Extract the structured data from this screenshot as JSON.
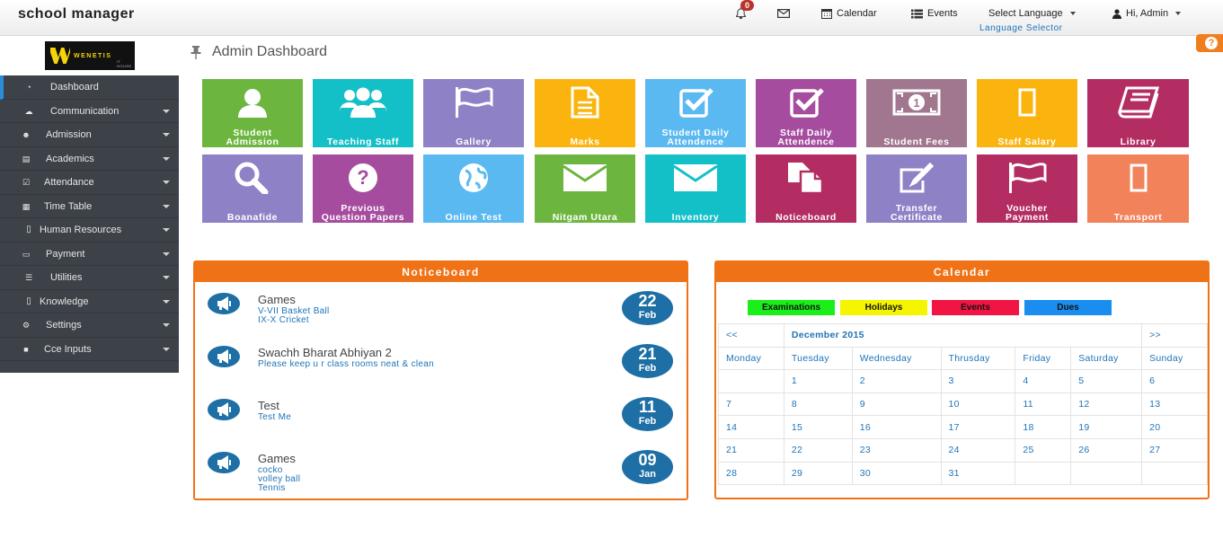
{
  "app": {
    "title": "school manager"
  },
  "topnav": {
    "notifications_count": "0",
    "calendar_label": "Calendar",
    "events_label": "Events",
    "language_label": "Select Language",
    "language_sub": "Language Selector",
    "user_label": "Hi, Admin"
  },
  "logo": {
    "text": "WENETIS",
    "sub": "IT HOUSE"
  },
  "sidebar": {
    "items": [
      {
        "label": "Dashboard",
        "icon": "dashboard-icon"
      },
      {
        "label": "Communication",
        "icon": "comments-icon"
      },
      {
        "label": "Admission",
        "icon": "users-icon"
      },
      {
        "label": "Academics",
        "icon": "keyboard-icon"
      },
      {
        "label": "Attendance",
        "icon": "check-square-icon"
      },
      {
        "label": "Time Table",
        "icon": "table-icon"
      },
      {
        "label": "Human Resources",
        "icon": "missing-glyph-icon"
      },
      {
        "label": "Payment",
        "icon": "money-icon"
      },
      {
        "label": "Utilities",
        "icon": "server-icon"
      },
      {
        "label": "Knowledge",
        "icon": "missing-glyph-icon"
      },
      {
        "label": "Settings",
        "icon": "cogs-icon"
      },
      {
        "label": "Cce Inputs",
        "icon": "folder-icon"
      }
    ]
  },
  "page": {
    "title": "Admin Dashboard"
  },
  "tiles": [
    {
      "label": "Student\nAdmission",
      "icon": "user-icon",
      "color": "#6cb63f"
    },
    {
      "label": "Teaching Staff",
      "icon": "group-icon",
      "color": "#13c0c8"
    },
    {
      "label": "Gallery",
      "icon": "flag-icon",
      "color": "#8f81c6"
    },
    {
      "label": "Marks",
      "icon": "file-text-icon",
      "color": "#fbb40e"
    },
    {
      "label": "Student Daily\nAttendence",
      "icon": "check-square-icon",
      "color": "#5bb9f1"
    },
    {
      "label": "Staff Daily\nAttendence",
      "icon": "check-square-icon",
      "color": "#a64c9e"
    },
    {
      "label": "Student Fees",
      "icon": "money-icon",
      "color": "#a1778f"
    },
    {
      "label": "Staff Salary",
      "icon": "missing-glyph-icon",
      "color": "#fbb40e"
    },
    {
      "label": "Library",
      "icon": "book-icon",
      "color": "#b32d63"
    },
    {
      "label": "Boanafide",
      "icon": "search-icon",
      "color": "#8f81c6"
    },
    {
      "label": "Previous\nQuestion Papers",
      "icon": "question-icon",
      "color": "#a64c9e"
    },
    {
      "label": "Online Test",
      "icon": "globe-icon",
      "color": "#5bb9f1"
    },
    {
      "label": "Nitgam Utara",
      "icon": "envelope-icon",
      "color": "#6cb63f"
    },
    {
      "label": "Inventory",
      "icon": "envelope-icon",
      "color": "#13c0c8"
    },
    {
      "label": "Noticeboard",
      "icon": "files-icon",
      "color": "#b32d63"
    },
    {
      "label": "Transfer\nCertificate",
      "icon": "edit-icon",
      "color": "#8f81c6"
    },
    {
      "label": "Voucher\nPayment",
      "icon": "flag-icon",
      "color": "#b32d63"
    },
    {
      "label": "Transport",
      "icon": "missing-glyph-icon",
      "color": "#f1825a"
    }
  ],
  "noticeboard": {
    "title": "Noticeboard",
    "items": [
      {
        "title": "Games",
        "lines": [
          "V-VII Basket Ball",
          "IX-X Cricket"
        ],
        "day": "22",
        "month": "Feb"
      },
      {
        "title": "Swachh Bharat Abhiyan 2",
        "lines": [
          "Please keep u r class rooms neat & clean"
        ],
        "day": "21",
        "month": "Feb"
      },
      {
        "title": "Test",
        "lines": [
          "Test Me"
        ],
        "day": "11",
        "month": "Feb"
      },
      {
        "title": "Games",
        "lines": [
          "cocko",
          "volley ball",
          "Tennis"
        ],
        "day": "09",
        "month": "Jan"
      }
    ]
  },
  "calendar": {
    "title": "Calendar",
    "legend": [
      {
        "label": "Examinations",
        "color": "#1aef1a"
      },
      {
        "label": "Holidays",
        "color": "#f5f500"
      },
      {
        "label": "Events",
        "color": "#f01542"
      },
      {
        "label": "Dues",
        "color": "#1a8ef0"
      }
    ],
    "prev": "<<",
    "next": ">>",
    "month": "December 2015",
    "weekdays": [
      "Monday",
      "Tuesday",
      "Wednesday",
      "Thrusday",
      "Friday",
      "Saturday",
      "Sunday"
    ],
    "weeks": [
      [
        "",
        "1",
        "2",
        "3",
        "4",
        "5",
        "6"
      ],
      [
        "7",
        "8",
        "9",
        "10",
        "11",
        "12",
        "13"
      ],
      [
        "14",
        "15",
        "16",
        "17",
        "18",
        "19",
        "20"
      ],
      [
        "21",
        "22",
        "23",
        "24",
        "25",
        "26",
        "27"
      ],
      [
        "28",
        "29",
        "30",
        "31",
        "",
        "",
        ""
      ]
    ]
  }
}
